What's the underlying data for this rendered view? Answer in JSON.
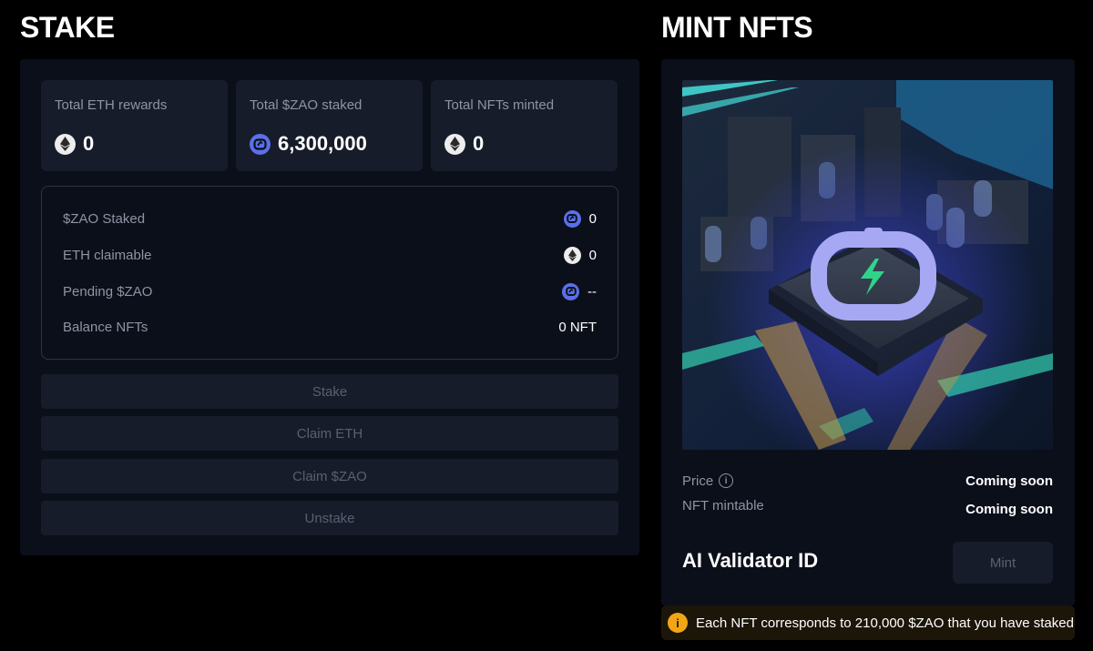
{
  "stake": {
    "title": "STAKE",
    "stats": [
      {
        "label": "Total ETH rewards",
        "value": "0",
        "icon": "eth-icon"
      },
      {
        "label": "Total $ZAO staked",
        "value": "6,300,000",
        "icon": "zao-icon"
      },
      {
        "label": "Total NFTs minted",
        "value": "0",
        "icon": "eth-icon"
      }
    ],
    "details": [
      {
        "label": "$ZAO Staked",
        "value": "0",
        "icon": "zao-icon"
      },
      {
        "label": "ETH claimable",
        "value": "0",
        "icon": "eth-icon"
      },
      {
        "label": "Pending $ZAO",
        "value": "--",
        "icon": "zao-icon"
      },
      {
        "label": "Balance NFTs",
        "value": "0 NFT",
        "icon": ""
      }
    ],
    "buttons": {
      "stake": "Stake",
      "claim_eth": "Claim ETH",
      "claim_zao": "Claim $ZAO",
      "unstake": "Unstake"
    }
  },
  "mint": {
    "title": "MINT NFTS",
    "price_label": "Price",
    "price_value": "Coming soon",
    "mintable_label": "NFT mintable",
    "mintable_value": "Coming soon",
    "validator_title": "AI Validator ID",
    "mint_button": "Mint",
    "notice": "Each NFT corresponds to 210,000 $ZAO that you have staked",
    "notice_icon": "warning-info-icon"
  },
  "colors": {
    "background": "#000000",
    "panel": "#0b0f1a",
    "card": "#161c2a",
    "muted_text": "#8d94a3",
    "zao_blue": "#5a70e8",
    "warning": "#f2a615"
  }
}
